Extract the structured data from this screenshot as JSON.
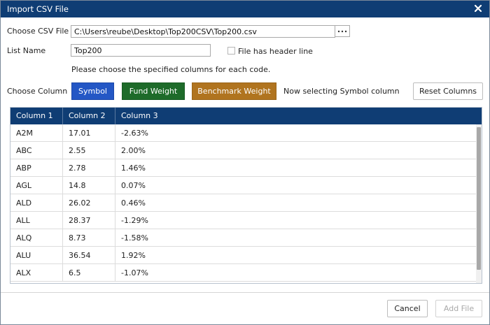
{
  "dialog": {
    "title": "Import CSV File",
    "close_icon": "close-icon"
  },
  "form": {
    "choose_csv_label": "Choose CSV File",
    "csv_path": "C:\\Users\\reube\\Desktop\\Top200CSV\\Top200.csv",
    "browse_icon": "ellipsis-icon",
    "list_name_label": "List Name",
    "list_name_value": "Top200",
    "header_line_label": "File has header line",
    "header_line_checked": false,
    "instruction": "Please choose the specified columns for each code."
  },
  "columns": {
    "choose_label": "Choose Column",
    "symbol_label": "Symbol",
    "fund_weight_label": "Fund Weight",
    "benchmark_weight_label": "Benchmark Weight",
    "status_text": "Now selecting Symbol column",
    "reset_label": "Reset Columns",
    "colors": {
      "symbol": "#2457c5",
      "fund_weight": "#1e6b2a",
      "benchmark_weight": "#b0741f",
      "header": "#0f3d74"
    }
  },
  "grid": {
    "headers": [
      "Column 1",
      "Column 2",
      "Column 3"
    ],
    "rows": [
      [
        "A2M",
        "17.01",
        "-2.63%"
      ],
      [
        "ABC",
        "2.55",
        "2.00%"
      ],
      [
        "ABP",
        "2.78",
        "1.46%"
      ],
      [
        "AGL",
        "14.8",
        "0.07%"
      ],
      [
        "ALD",
        "26.02",
        "0.46%"
      ],
      [
        "ALL",
        "28.37",
        "-1.29%"
      ],
      [
        "ALQ",
        "8.73",
        "-1.58%"
      ],
      [
        "ALU",
        "36.54",
        "1.92%"
      ],
      [
        "ALX",
        "6.5",
        "-1.07%"
      ]
    ]
  },
  "footer": {
    "cancel_label": "Cancel",
    "add_file_label": "Add File"
  }
}
